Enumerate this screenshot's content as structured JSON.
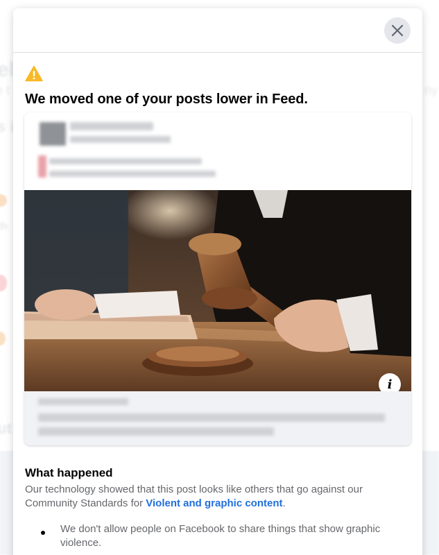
{
  "modal": {
    "title": "We moved one of your posts lower in Feed.",
    "close_icon": "close-icon",
    "warning_icon": "warning-icon",
    "warning_color": "#f7b928"
  },
  "post_preview": {
    "image_description": "judge-gavel-photo",
    "info_icon": "info-icon",
    "info_glyph": "i"
  },
  "what_happened": {
    "heading": "What happened",
    "text_before_link": "Our technology showed that this post looks like others that go against our Community Standards for ",
    "link_text": "Violent and graphic content",
    "text_after_link": ".",
    "bullets": [
      "We don't allow people on Facebook to share things that show graphic violence."
    ]
  },
  "colors": {
    "link": "#216fdb",
    "body_text": "#65676b",
    "heading_text": "#050505"
  }
}
